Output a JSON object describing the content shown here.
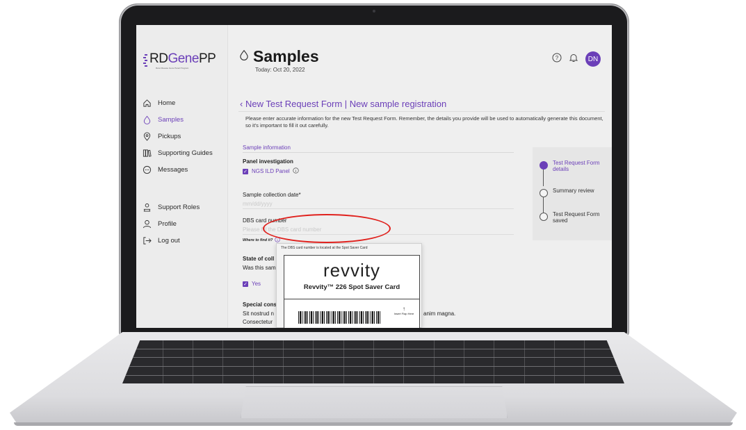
{
  "app": {
    "logo": {
      "prefix": "RD",
      "accent": "Gene",
      "suffix": "PP",
      "tagline": "Rare Disease Gene Panel Program"
    },
    "colors": {
      "accent": "#6b3fb8",
      "highlight": "#e0211d",
      "sidebar_bg": "#ececec",
      "content_bg": "#efefef"
    }
  },
  "sidebar": {
    "items": [
      {
        "label": "Home",
        "icon": "home-icon"
      },
      {
        "label": "Samples",
        "icon": "drop-icon",
        "active": true
      },
      {
        "label": "Pickups",
        "icon": "location-pin-icon"
      },
      {
        "label": "Supporting Guides",
        "icon": "books-icon"
      },
      {
        "label": "Messages",
        "icon": "chat-bubble-icon"
      },
      {
        "label": "Support Roles",
        "icon": "support-person-icon"
      },
      {
        "label": "Profile",
        "icon": "user-icon"
      },
      {
        "label": "Log out",
        "icon": "logout-icon"
      }
    ]
  },
  "header": {
    "title": "Samples",
    "date": "Today: Oct 20, 2022",
    "help_icon": "question-icon",
    "bell_icon": "bell-icon",
    "avatar": "DN"
  },
  "form": {
    "breadcrumb": "New Test Request Form | New sample registration",
    "intro": "Please enter accurate information for the new Test Request Form. Remember, the details you provide will be used to automatically generate this document, so it's important to fill it out carefully.",
    "section": "Sample information",
    "panel_label": "Panel investigation",
    "panel_option": "NGS ILD Panel",
    "collection_label": "Sample collection date*",
    "collection_placeholder": "mm/dd/yyyy",
    "dbs_label": "DBS card number",
    "dbs_placeholder": "Please fill the DBS card number",
    "where_link": "Where to find it?",
    "state_label": "State of coll",
    "state_question": "Was this sam",
    "yes_option": "Yes",
    "special_label": "Special cons",
    "special_text_1": "Sit nostrud n",
    "special_text_2": "Consectetur",
    "special_text_tail": "anim magna."
  },
  "stepper": {
    "steps": [
      {
        "label": "Test Request Form details",
        "active": true
      },
      {
        "label": "Summary review",
        "active": false
      },
      {
        "label": "Test Request Form saved",
        "active": false
      }
    ]
  },
  "popup": {
    "caption": "The DBS card number is located at the Spot Saver Card",
    "card_brand": "revvity",
    "card_name": "Revvity™ 226 Spot Saver Card",
    "flap_label": "Insert Flap Here"
  }
}
